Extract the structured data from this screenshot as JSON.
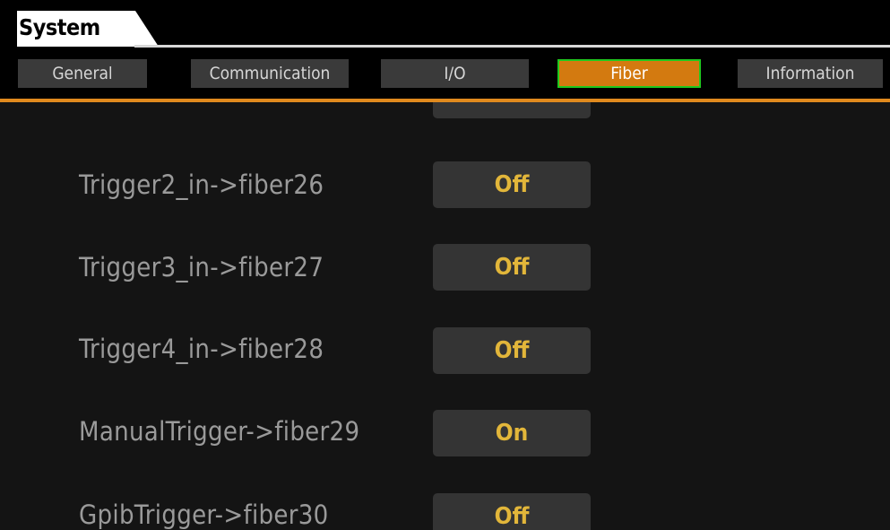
{
  "header": {
    "title": "System"
  },
  "tabs": [
    {
      "label": "General",
      "active": false
    },
    {
      "label": "Communication",
      "active": false
    },
    {
      "label": "I/O",
      "active": false
    },
    {
      "label": "Fiber",
      "active": true
    },
    {
      "label": "Information",
      "active": false
    }
  ],
  "settings": [
    {
      "label": "Trigger2_in->fiber26",
      "value": "Off"
    },
    {
      "label": "Trigger3_in->fiber27",
      "value": "Off"
    },
    {
      "label": "Trigger4_in->fiber28",
      "value": "Off"
    },
    {
      "label": "ManualTrigger->fiber29",
      "value": "On"
    },
    {
      "label": "GpibTrigger->fiber30",
      "value": "Off"
    }
  ],
  "colors": {
    "accent": "#e08a1e",
    "active_tab": "#d37a10",
    "active_tab_border": "#1fc81f",
    "toggle_text": "#e2b63a",
    "label_text": "#9a9a9a"
  }
}
